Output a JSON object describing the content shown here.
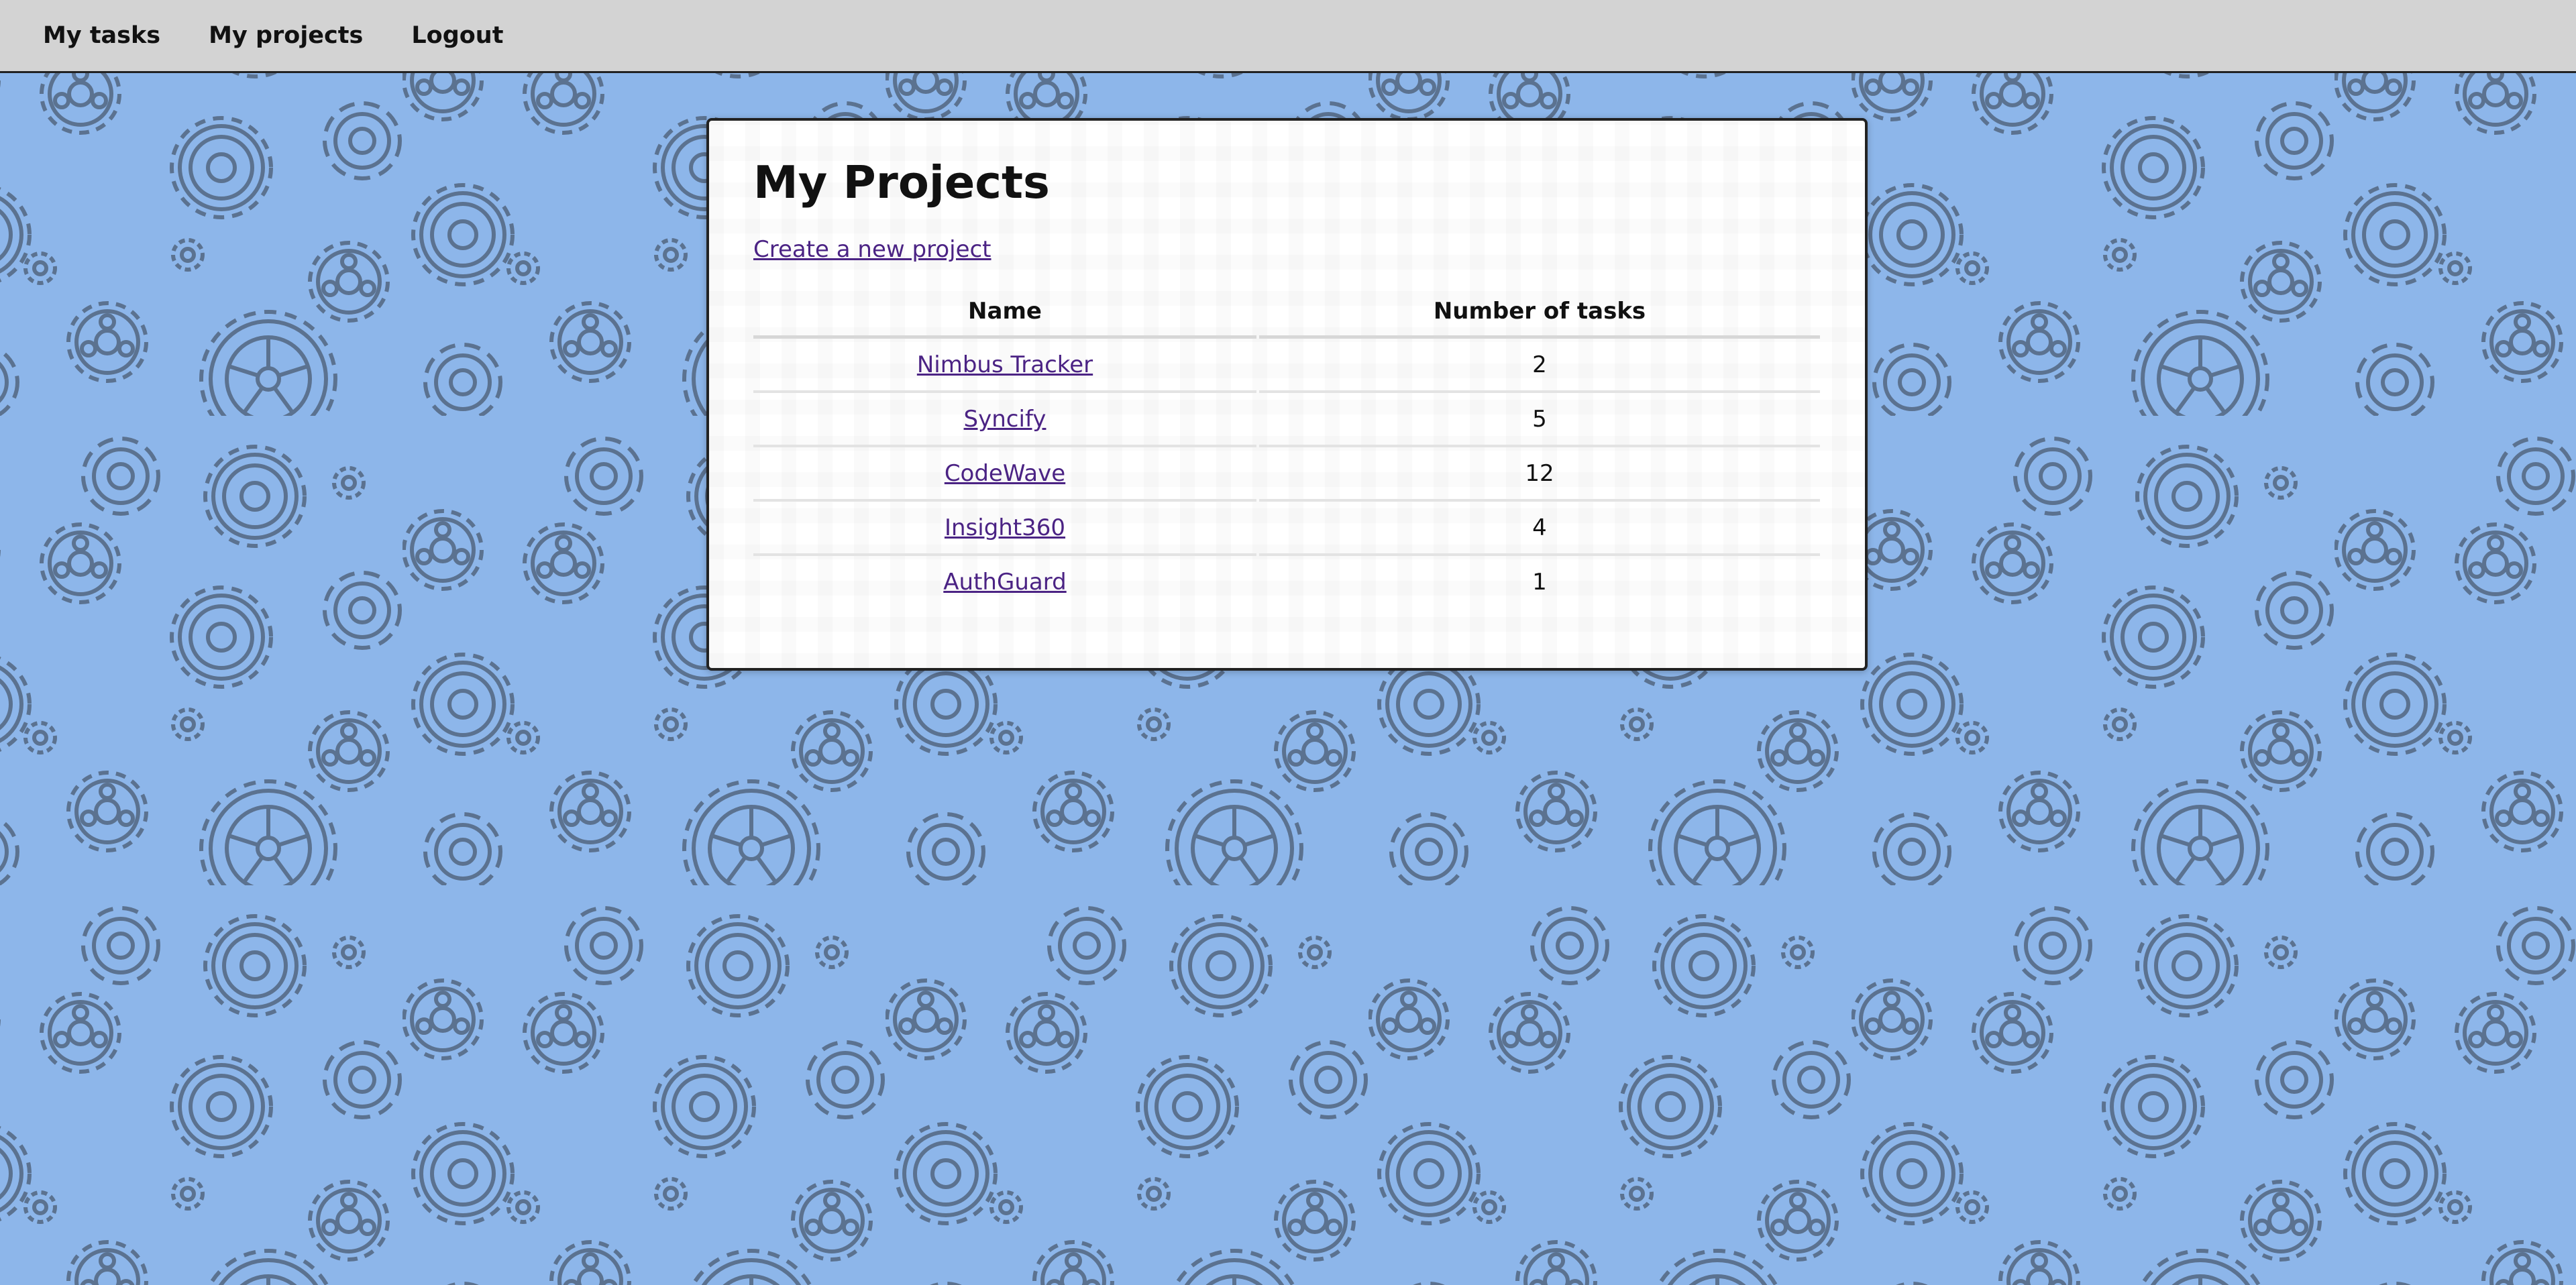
{
  "nav": {
    "items": [
      {
        "label": "My tasks"
      },
      {
        "label": "My projects"
      },
      {
        "label": "Logout"
      }
    ]
  },
  "main": {
    "title": "My Projects",
    "create_link": "Create a new project",
    "table": {
      "headers": [
        "Name",
        "Number of tasks"
      ],
      "rows": [
        {
          "name": "Nimbus Tracker",
          "tasks": "2"
        },
        {
          "name": "Syncify",
          "tasks": "5"
        },
        {
          "name": "CodeWave",
          "tasks": "12"
        },
        {
          "name": "Insight360",
          "tasks": "4"
        },
        {
          "name": "AuthGuard",
          "tasks": "1"
        }
      ]
    }
  },
  "colors": {
    "background": "#8db6ea",
    "gear_stroke": "#5b7290",
    "nav_bar": "#d3d3d3",
    "link": "#4b2384"
  },
  "icons": {
    "background_pattern": "gear-icon"
  }
}
